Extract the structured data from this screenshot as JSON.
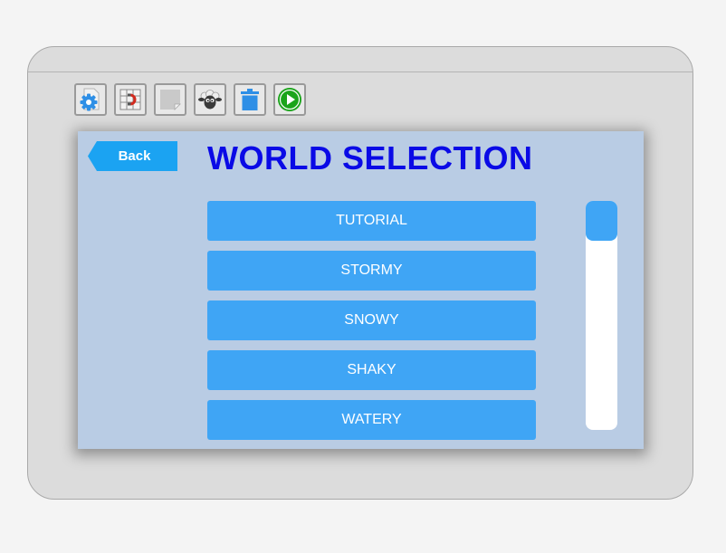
{
  "toolbar": {
    "tools": [
      {
        "icon": "settings-gear-icon"
      },
      {
        "icon": "magnet-grid-icon"
      },
      {
        "icon": "blank-page-icon"
      },
      {
        "icon": "sheep-icon"
      },
      {
        "icon": "trash-icon"
      },
      {
        "icon": "play-icon"
      }
    ]
  },
  "panel": {
    "back_label": "Back",
    "title": "WORLD SELECTION",
    "worlds": [
      "TUTORIAL",
      "STORMY",
      "SNOWY",
      "SHAKY",
      "WATERY"
    ],
    "scroll_position": 0
  },
  "colors": {
    "title": "#0a0ae6",
    "back_button": "#1ba3f2",
    "list_button": "#3fa5f5",
    "panel_bg": "#b9cce4",
    "play_green": "#1aa41a",
    "trash_blue": "#2e8fe6",
    "magnet_red": "#d32a1e"
  }
}
